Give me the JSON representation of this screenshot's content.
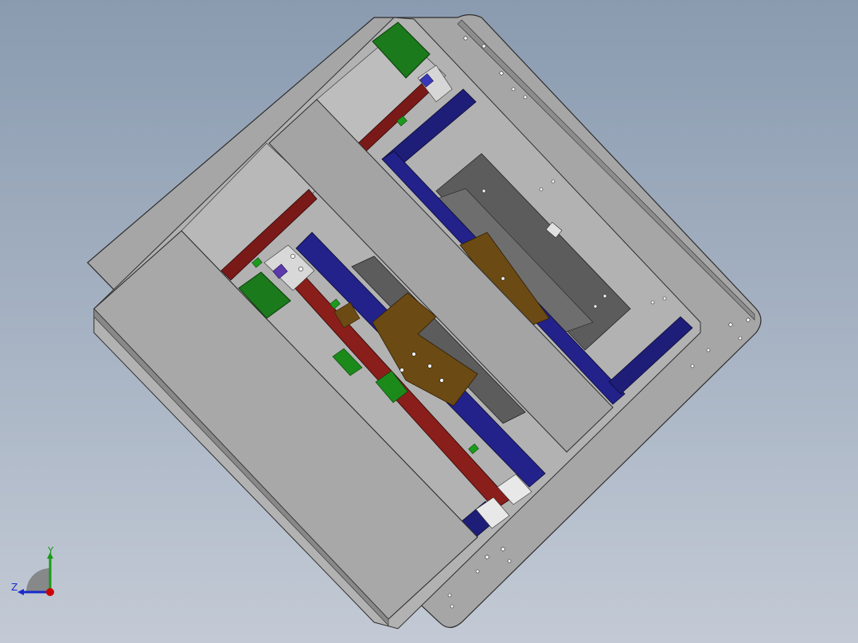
{
  "viewport": {
    "background_top": "#8a9bb0",
    "background_bottom": "#c3cad5"
  },
  "colors": {
    "plate": "#a6a6a6",
    "plate_dark": "#7d7d7d",
    "edge": "#2e2e2e",
    "rail_blue": "#1e1e78",
    "rod_red": "#7a1a18",
    "motor_green": "#1b7a1b",
    "bracket_brown": "#6b4a14",
    "block_gray": "#5a5a5a"
  },
  "triad": {
    "y_label": "Y",
    "z_label": "Z",
    "x_axis_color": "#cc0000",
    "y_axis_color": "#1a9a1a",
    "z_axis_color": "#1a2acc"
  }
}
